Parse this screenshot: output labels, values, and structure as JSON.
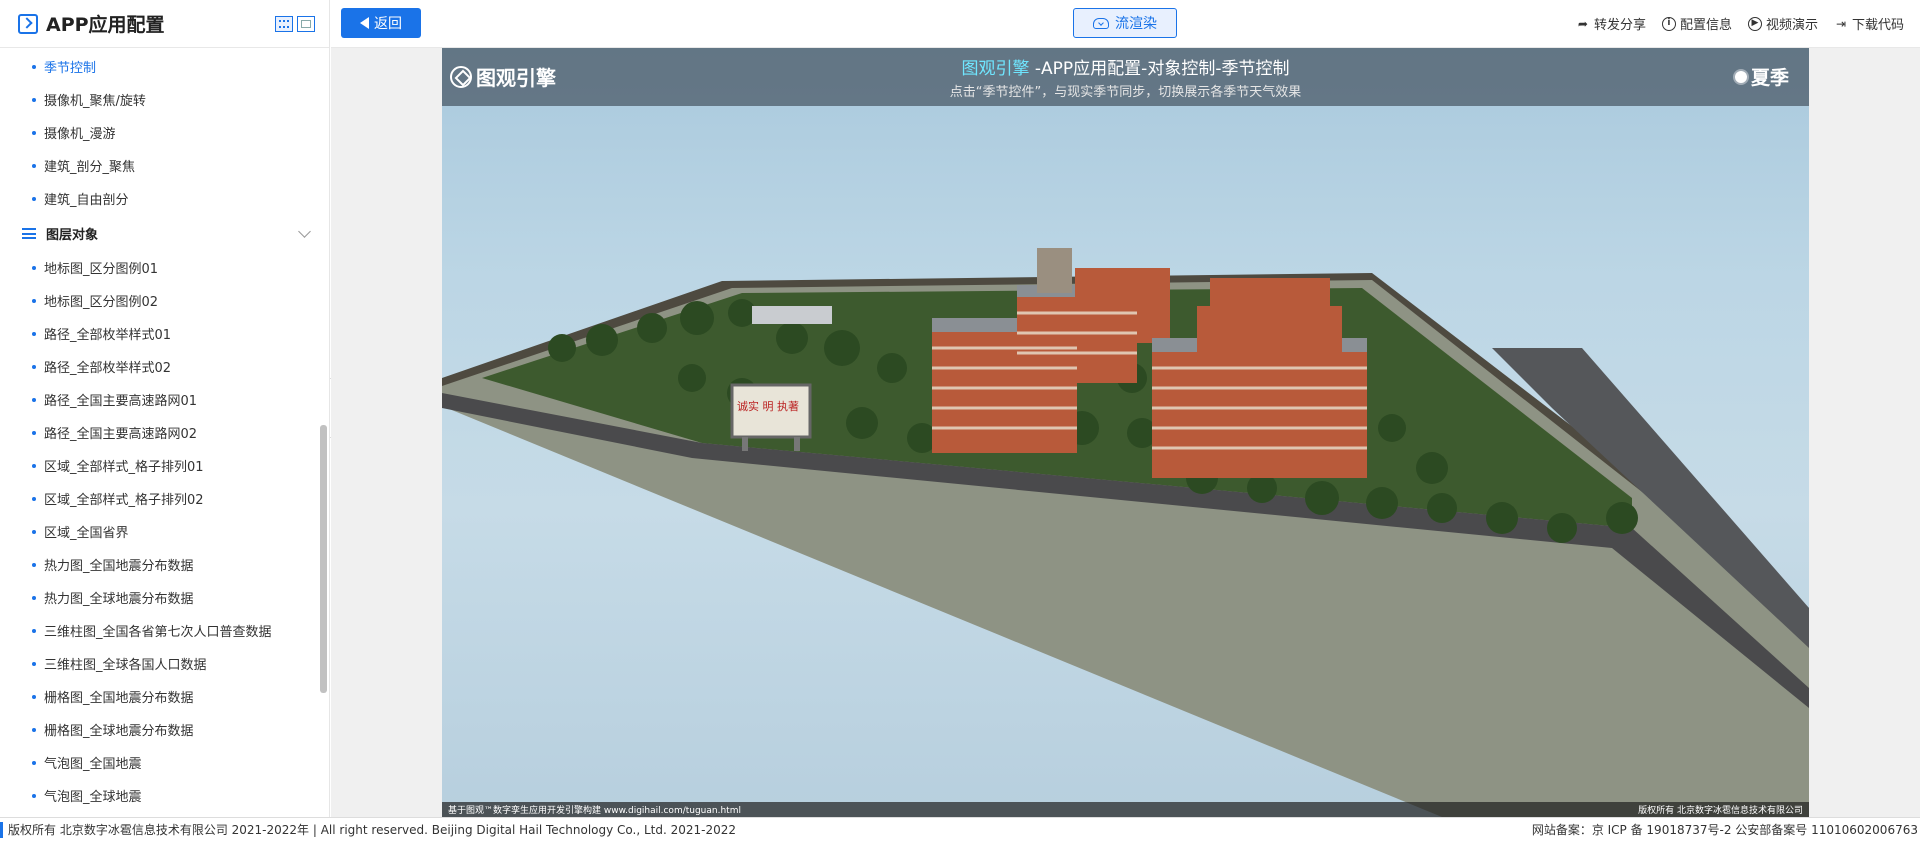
{
  "sidebar": {
    "title": "APP应用配置",
    "items_top": [
      {
        "label": "季节控制",
        "active": true
      },
      {
        "label": "摄像机_聚焦/旋转"
      },
      {
        "label": "摄像机_漫游"
      },
      {
        "label": "建筑_剖分_聚焦"
      },
      {
        "label": "建筑_自由剖分"
      }
    ],
    "group": {
      "label": "图层对象"
    },
    "items_group": [
      {
        "label": "地标图_区分图例01"
      },
      {
        "label": "地标图_区分图例02"
      },
      {
        "label": "路径_全部枚举样式01"
      },
      {
        "label": "路径_全部枚举样式02"
      },
      {
        "label": "路径_全国主要高速路网01"
      },
      {
        "label": "路径_全国主要高速路网02"
      },
      {
        "label": "区域_全部样式_格子排列01"
      },
      {
        "label": "区域_全部样式_格子排列02"
      },
      {
        "label": "区域_全国省界"
      },
      {
        "label": "热力图_全国地震分布数据"
      },
      {
        "label": "热力图_全球地震分布数据"
      },
      {
        "label": "三维柱图_全国各省第七次人口普查数据"
      },
      {
        "label": "三维柱图_全球各国人口数据"
      },
      {
        "label": "栅格图_全国地震分布数据"
      },
      {
        "label": "栅格图_全球地震分布数据"
      },
      {
        "label": "气泡图_全国地震"
      },
      {
        "label": "气泡图_全球地震"
      }
    ]
  },
  "toolbar": {
    "back_label": "返回",
    "render_label": "流渲染",
    "actions": [
      {
        "label": "转发分享",
        "icon": "share-icon"
      },
      {
        "label": "配置信息",
        "icon": "info-icon"
      },
      {
        "label": "视频演示",
        "icon": "play-icon"
      },
      {
        "label": "下载代码",
        "icon": "download-icon"
      }
    ]
  },
  "viewer": {
    "brand": "图观引擎",
    "title_highlight": "图观引擎",
    "title_rest": " -APP应用配置-对象控制-季节控制",
    "subtitle": "点击“季节控件”，与现实季节同步，切换展示各季节天气效果",
    "season": "夏季",
    "billboard": "诚实 明 执著",
    "footer_left": "基于图观™数字孪生应用开发引擎构建 www.digihail.com/tuguan.html",
    "footer_right": "版权所有 北京数字冰雹信息技术有限公司"
  },
  "footer": {
    "copyright": "版权所有 北京数字冰雹信息技术有限公司 2021-2022年 | All right reserved. Beijing Digital Hail Technology Co., Ltd. 2021-2022",
    "icp": "网站备案：京 ICP 备 19018737号-2 公安部备案号 11010602006763"
  }
}
